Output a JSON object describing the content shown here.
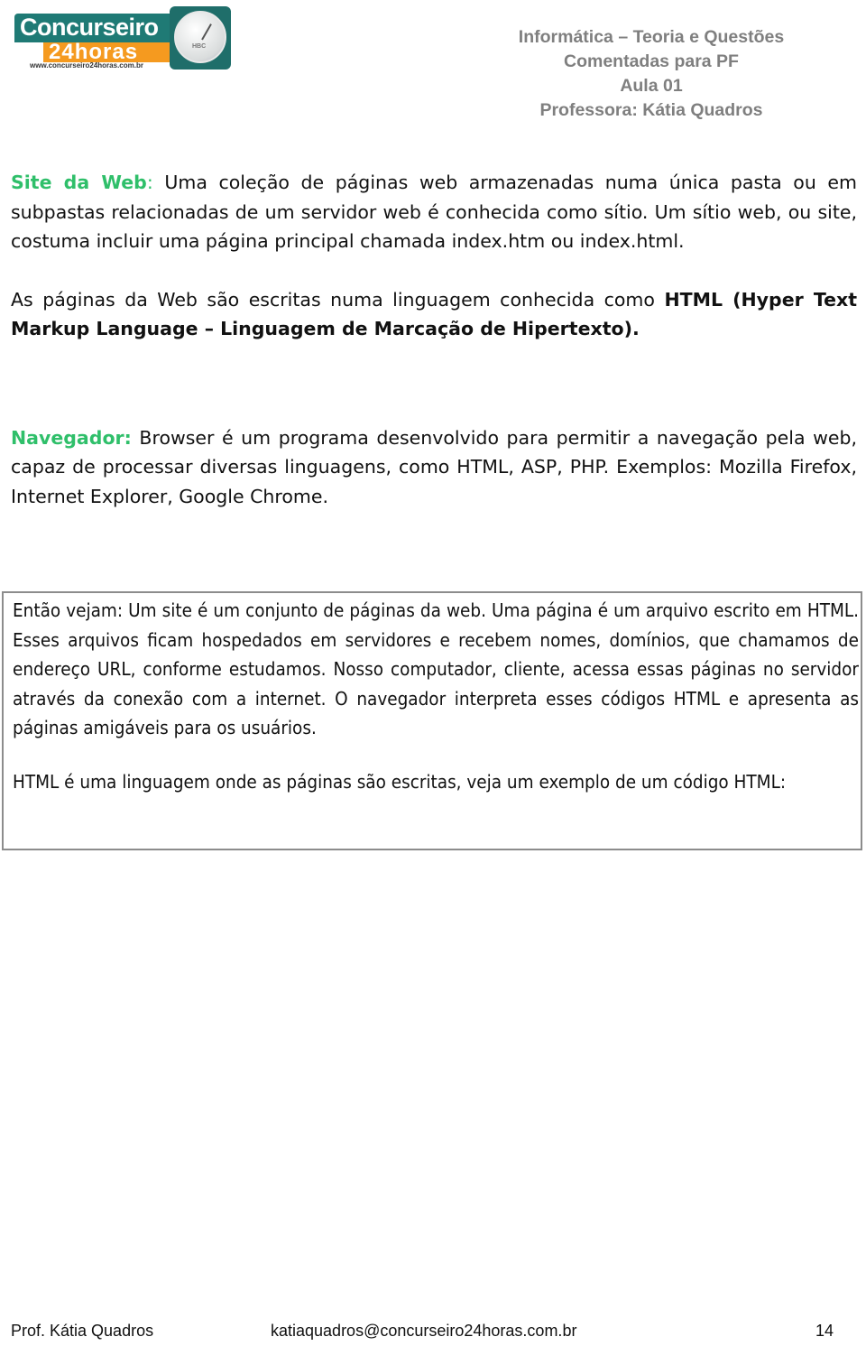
{
  "logo": {
    "line1": "Concurseiro",
    "line2": "24horas",
    "url": "www.concurseiro24horas.com.br",
    "clock_label": "HBC",
    "colors": {
      "teal": "#1f7a75",
      "orange": "#f59a1f"
    }
  },
  "header": {
    "lines": [
      "Informática – Teoria e Questões",
      "Comentadas para PF",
      "Aula 01",
      "Professora: Kátia Quadros"
    ],
    "color": "#7f7f7f"
  },
  "body": {
    "accent_color": "#2fbf6a",
    "site_web": {
      "term": "Site da Web",
      "colon": ":",
      "text": " Uma coleção de páginas web armazenadas numa única pasta ou em subpastas relacionadas de um servidor web é conhecida como sítio. Um sítio web, ou site, costuma incluir uma página principal chamada index.htm ou index.html."
    },
    "html_paragraph": {
      "text": "As páginas da Web são escritas numa linguagem conhecida como ",
      "bold": "HTML (Hyper Text Markup Language – Linguagem de Marcação de Hipertexto)."
    },
    "navegador": {
      "term": "Navegador:",
      "text": " Browser é um programa desenvolvido para permitir a navegação pela web, capaz de processar diversas linguagens, como HTML, ASP, PHP. Exemplos: Mozilla Firefox, Internet Explorer, Google Chrome."
    }
  },
  "box": {
    "paragraph1": "Então vejam: Um site é um conjunto de páginas da web. Uma página é um arquivo escrito em HTML. Esses arquivos ficam hospedados em servidores e recebem nomes, domínios, que chamamos de endereço URL, conforme estudamos. Nosso computador, cliente, acessa essas páginas no servidor através da conexão com a internet. O navegador interpreta esses códigos HTML e apresenta as páginas amigáveis para os usuários.",
    "paragraph2": "HTML é uma linguagem onde as páginas são escritas, veja um exemplo de um código HTML:"
  },
  "footer": {
    "author": "Prof. Kátia Quadros",
    "email": "katiaquadros@concurseiro24horas.com.br",
    "page_number": "14"
  }
}
